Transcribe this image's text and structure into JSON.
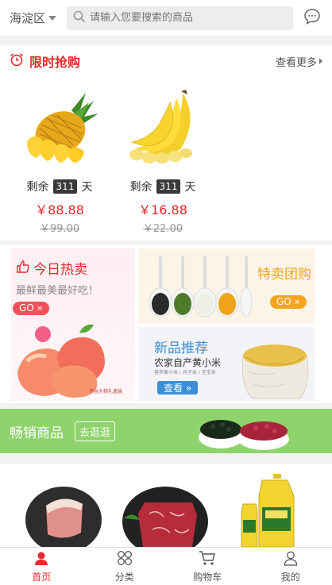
{
  "header": {
    "location": "海淀区",
    "search_placeholder": "请输入您要搜索的商品"
  },
  "flash_sale": {
    "title": "限时抢购",
    "more": "查看更多",
    "products": [
      {
        "remain_prefix": "剩余",
        "days": "311",
        "remain_suffix": "天",
        "price": "￥88.88",
        "original_price": "￥99.00"
      },
      {
        "remain_prefix": "剩余",
        "days": "311",
        "remain_suffix": "天",
        "price": "￥16.88",
        "original_price": "￥22.00"
      }
    ]
  },
  "promo": {
    "hot_today": {
      "title": "今日热卖",
      "subtitle": "最鲜最美最好吃！",
      "go": "GO »"
    },
    "group_buy": {
      "title": "特卖团购",
      "go": "GO »"
    },
    "new": {
      "title": "新品推荐",
      "brand": "农家自产黄小米",
      "tagline": "营养黄小米 / 月子米 / 宝宝米",
      "btn": "查看 »"
    }
  },
  "bestseller": {
    "title": "畅销商品",
    "button": "去逛逛"
  },
  "tabs": [
    {
      "label": "首页"
    },
    {
      "label": "分类"
    },
    {
      "label": "购物车"
    },
    {
      "label": "我的"
    }
  ],
  "colors": {
    "accent": "#e8282a",
    "green": "#8ed36b",
    "button_red": "#f2505a",
    "button_orange": "#f7a41e"
  }
}
